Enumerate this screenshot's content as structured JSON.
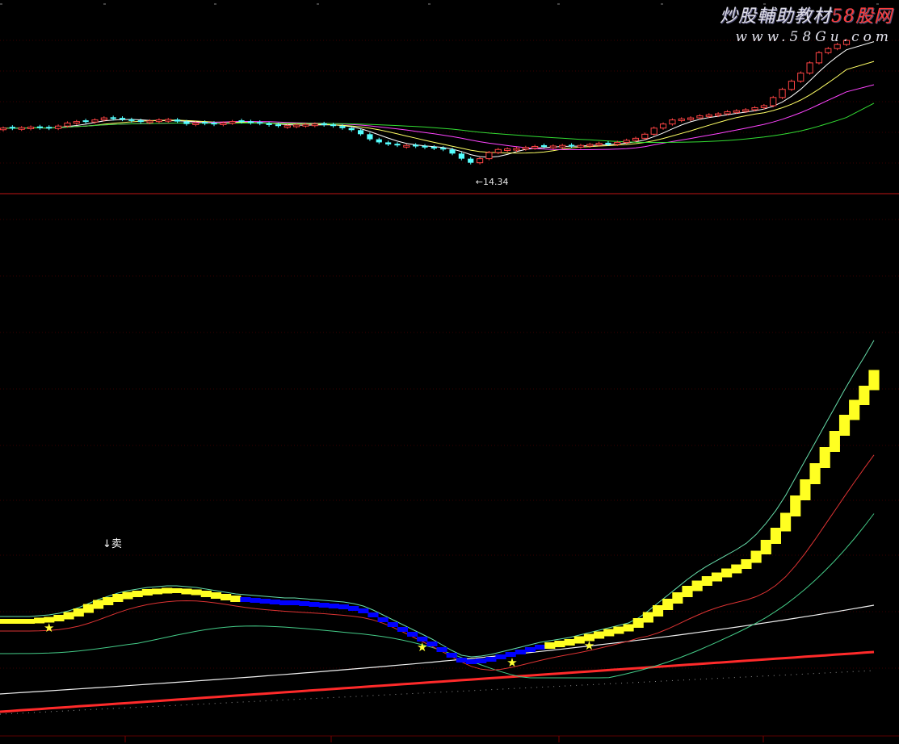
{
  "watermark": {
    "site_name": "炒股輔助教材",
    "site_brand": "58股网",
    "url": "www.58Gu.com"
  },
  "chart_data": [
    {
      "type": "candlestick",
      "panel": "price",
      "title": "",
      "annotations": [
        {
          "label": "←14.34",
          "kind": "low_marker",
          "bar_index": 51
        }
      ],
      "y_range_est": [
        13.4,
        21.0
      ],
      "candles_est": {
        "close": [
          16.3,
          16.28,
          16.32,
          16.35,
          16.3,
          16.28,
          16.4,
          16.55,
          16.62,
          16.6,
          16.7,
          16.8,
          16.75,
          16.72,
          16.65,
          16.6,
          16.65,
          16.7,
          16.72,
          16.62,
          16.5,
          16.55,
          16.52,
          16.48,
          16.55,
          16.62,
          16.6,
          16.55,
          16.52,
          16.45,
          16.4,
          16.42,
          16.45,
          16.48,
          16.5,
          16.45,
          16.4,
          16.3,
          16.2,
          16.0,
          15.75,
          15.6,
          15.5,
          15.45,
          15.45,
          15.4,
          15.35,
          15.3,
          15.25,
          15.05,
          14.8,
          14.6,
          14.8,
          15.1,
          15.25,
          15.28,
          15.3,
          15.35,
          15.4,
          15.38,
          15.42,
          15.45,
          15.4,
          15.45,
          15.5,
          15.55,
          15.5,
          15.6,
          15.7,
          15.8,
          16.0,
          16.3,
          16.5,
          16.7,
          16.75,
          16.8,
          16.9,
          16.95,
          17.0,
          17.1,
          17.15,
          17.2,
          17.3,
          17.4,
          17.8,
          18.2,
          18.6,
          19.0,
          19.5,
          20.0,
          20.2,
          20.4,
          20.6
        ],
        "rising": [
          true,
          false,
          true,
          true,
          false,
          false,
          true,
          true,
          true,
          false,
          true,
          true,
          false,
          false,
          false,
          false,
          true,
          true,
          true,
          false,
          false,
          true,
          false,
          false,
          true,
          true,
          false,
          false,
          false,
          false,
          false,
          true,
          true,
          true,
          true,
          false,
          false,
          false,
          false,
          false,
          false,
          false,
          false,
          false,
          true,
          false,
          false,
          false,
          false,
          false,
          false,
          false,
          true,
          true,
          true,
          true,
          true,
          true,
          true,
          false,
          true,
          true,
          false,
          true,
          true,
          true,
          false,
          true,
          true,
          true,
          true,
          true,
          true,
          true,
          true,
          true,
          true,
          true,
          true,
          true,
          true,
          true,
          true,
          true,
          true,
          true,
          true,
          true,
          true,
          true,
          true,
          true,
          true
        ]
      },
      "moving_averages": [
        {
          "color": "#ffffff",
          "role": "short"
        },
        {
          "color": "#ffff66",
          "role": "medium"
        },
        {
          "color": "#ff44ff",
          "role": "long"
        },
        {
          "color": "#33dd33",
          "role": "longest"
        }
      ]
    },
    {
      "type": "indicator",
      "panel": "oscillator",
      "title": "",
      "labels": [
        {
          "text": "↓卖",
          "bar_index": 21
        }
      ],
      "signal_marker": "★",
      "signal_bars": [
        5,
        43,
        60,
        97
      ],
      "colors": {
        "bull_block": "#ffff22",
        "bear_block": "#0000ff",
        "upper_band": "#66ddaa",
        "lower_band": "#dd3333",
        "mid_green": "#44cc88",
        "slow_white": "#f0f0f0",
        "base_red": "#ff2a2a",
        "dotted_grey": "#909090"
      },
      "main_line_est": [
        770,
        770,
        770,
        770,
        769,
        768,
        766,
        763,
        759,
        754,
        749,
        745,
        741,
        738,
        736,
        734,
        733,
        732,
        732,
        733,
        734,
        736,
        738,
        740,
        742,
        743,
        744,
        745,
        746,
        747,
        747,
        748,
        749,
        750,
        751,
        752,
        754,
        757,
        762,
        768,
        774,
        780,
        786,
        792,
        798,
        805,
        812,
        818,
        820,
        819,
        817,
        814,
        811,
        808,
        805,
        802,
        800,
        798,
        796,
        793,
        790,
        787,
        784,
        781,
        778,
        772,
        765,
        757,
        749,
        741,
        733,
        726,
        720,
        715,
        710,
        705,
        699,
        690,
        678,
        664,
        647,
        627,
        607,
        587,
        567,
        547,
        527,
        508,
        490,
        471
      ],
      "bull_segments": [
        [
          0,
          4
        ],
        [
          5,
          18
        ],
        [
          19,
          24
        ],
        [
          56,
          89
        ]
      ],
      "bear_segments": [
        [
          25,
          55
        ]
      ]
    }
  ]
}
